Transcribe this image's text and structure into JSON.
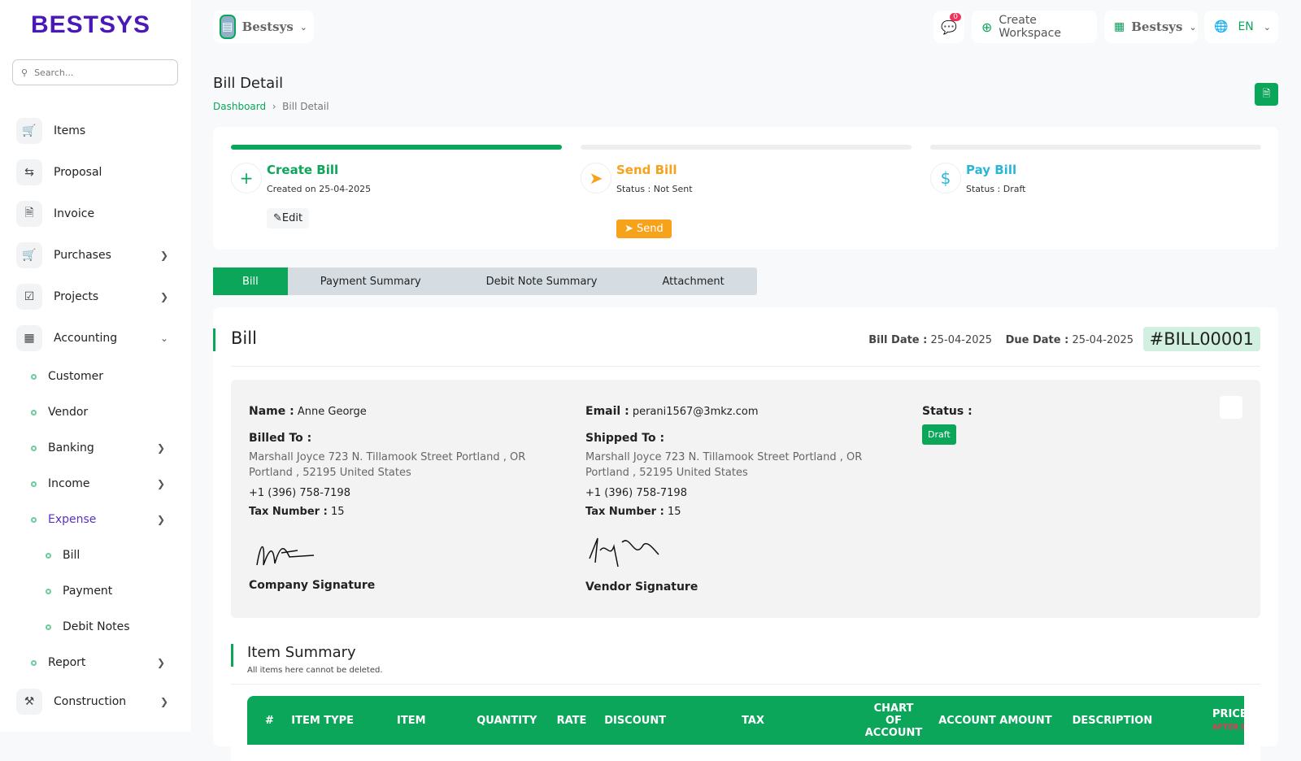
{
  "brand": "BESTSYS",
  "search": {
    "placeholder": "Search..."
  },
  "sidebar": {
    "items": [
      {
        "label": "Items"
      },
      {
        "label": "Proposal"
      },
      {
        "label": "Invoice"
      },
      {
        "label": "Purchases"
      },
      {
        "label": "Projects"
      },
      {
        "label": "Accounting"
      }
    ],
    "accounting_sub": [
      {
        "label": "Customer"
      },
      {
        "label": "Vendor"
      },
      {
        "label": "Banking"
      },
      {
        "label": "Income"
      },
      {
        "label": "Expense"
      }
    ],
    "expense_sub": [
      {
        "label": "Bill"
      },
      {
        "label": "Payment"
      },
      {
        "label": "Debit Notes"
      }
    ],
    "report": "Report",
    "construction": "Construction"
  },
  "topbar": {
    "workspace": "Bestsys",
    "notifications": "0",
    "create_workspace": "Create Workspace",
    "company": "Bestsys",
    "language": "EN"
  },
  "page": {
    "title": "Bill Detail",
    "breadcrumb": [
      "Dashboard",
      "Bill Detail"
    ]
  },
  "steps": [
    {
      "title": "Create Bill",
      "sub": "Created on 25-04-2025",
      "action": "Edit",
      "progress": 100
    },
    {
      "title": "Send Bill",
      "sub": "Status : Not Sent",
      "action": "Send",
      "progress": 0
    },
    {
      "title": "Pay Bill",
      "sub": "Status : Draft",
      "progress": 0
    }
  ],
  "tabs": [
    "Bill",
    "Payment Summary",
    "Debit Note Summary",
    "Attachment"
  ],
  "bill": {
    "heading": "Bill",
    "bill_date_label": "Bill Date :",
    "bill_date": "25-04-2025",
    "due_date_label": "Due Date :",
    "due_date": "25-04-2025",
    "number": "#BILL00001",
    "name_label": "Name :",
    "name": "Anne George",
    "email_label": "Email :",
    "email": "perani1567@3mkz.com",
    "status_label": "Status :",
    "status": "Draft",
    "billed_to_label": "Billed To :",
    "shipped_to_label": "Shipped To :",
    "address1": "Marshall Joyce 723 N. Tillamook Street Portland , OR",
    "address2": "Portland , 52195 United States",
    "phone": "+1 (396) 758-7198",
    "tax_label": "Tax Number :",
    "tax": "15",
    "company_sig": "Company Signature",
    "vendor_sig": "Vendor Signature"
  },
  "items": {
    "heading": "Item Summary",
    "note": "All items here cannot be deleted.",
    "columns": [
      "#",
      "ITEM TYPE",
      "ITEM",
      "QUANTITY",
      "RATE",
      "DISCOUNT",
      "TAX",
      "CHART OF ACCOUNT",
      "ACCOUNT AMOUNT",
      "DESCRIPTION",
      "PRICE"
    ],
    "price_sub": "AFTER DISCOUNT"
  },
  "colors": {
    "accent": "#0ca65a",
    "orange": "#f7a21b",
    "teal": "#2bb5d6",
    "purple": "#4a18b8"
  }
}
